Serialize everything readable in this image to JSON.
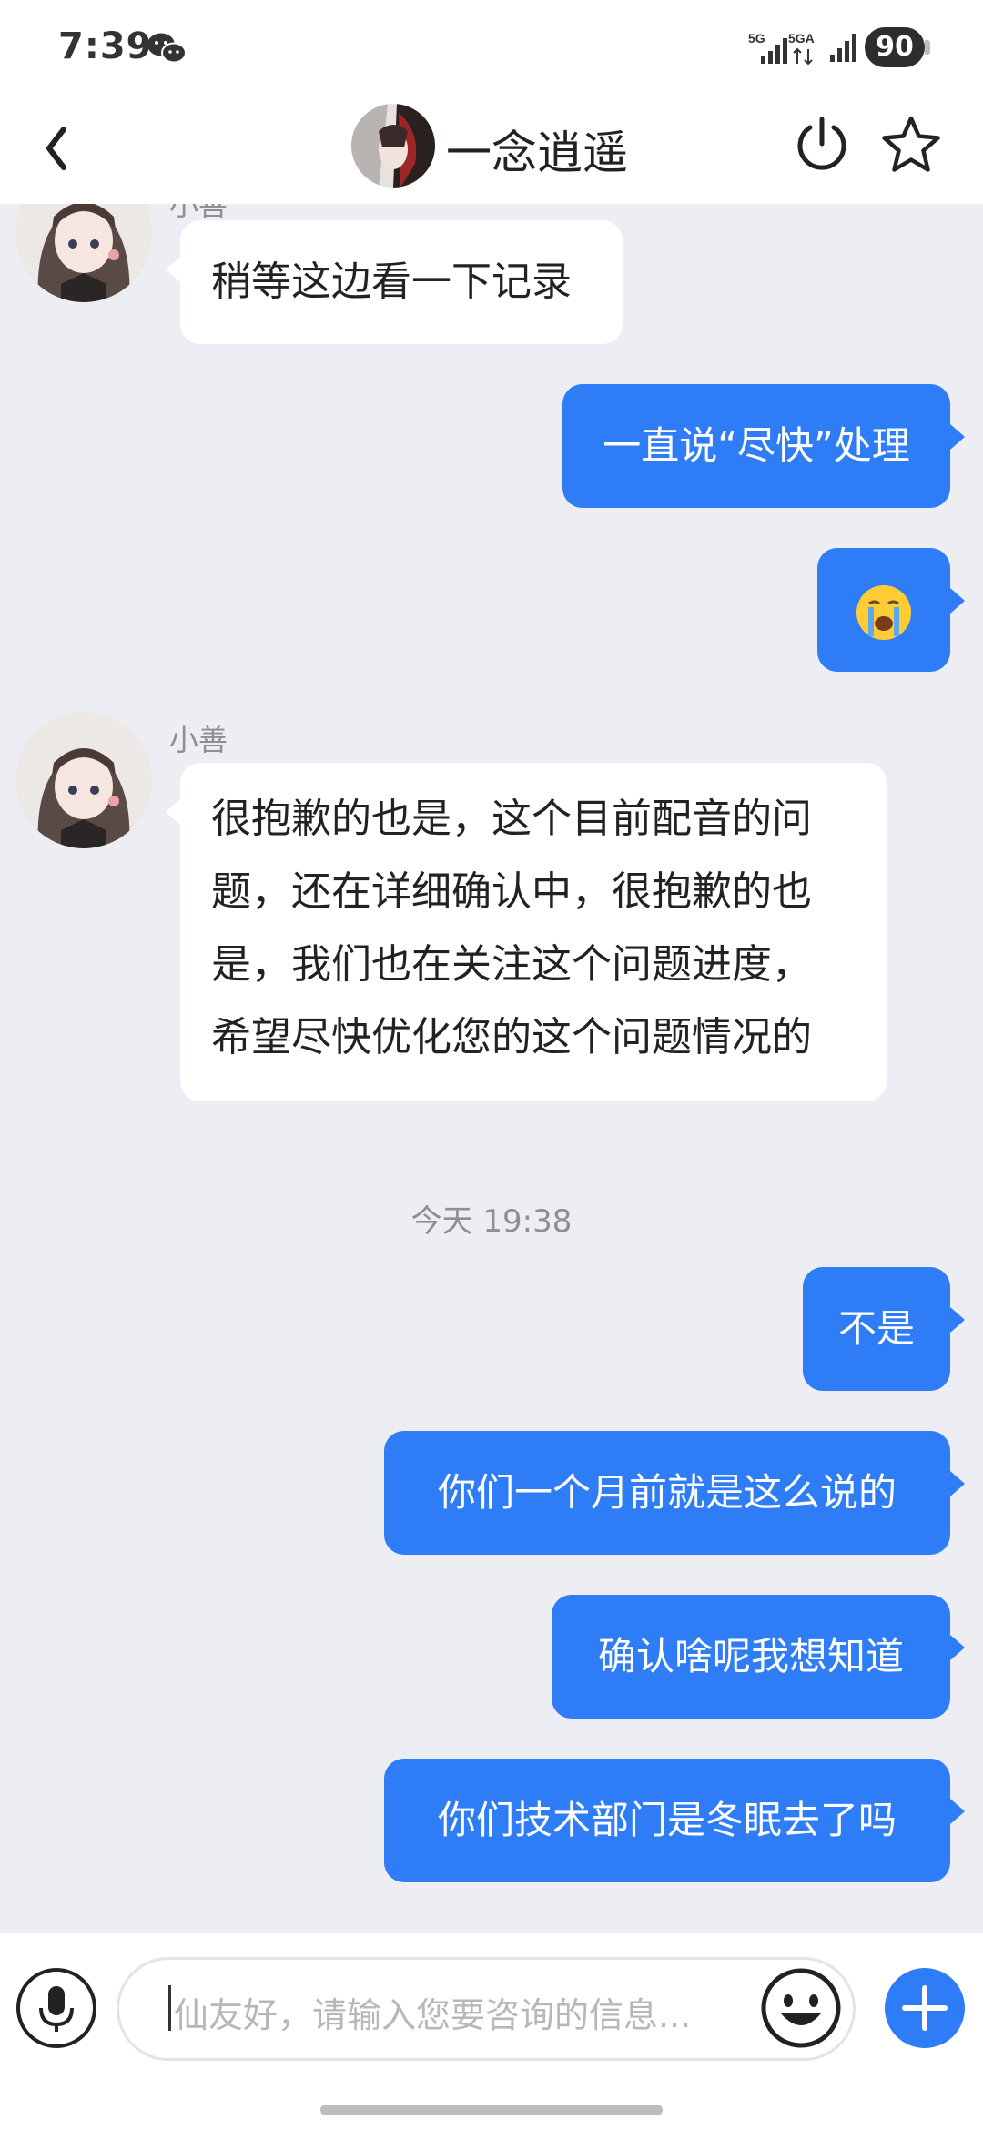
{
  "status_bar": {
    "time": "7:39",
    "signal1_label": "5G",
    "signal2_label": "5GA",
    "battery": "90"
  },
  "header": {
    "title": "一念逍遥"
  },
  "chat": {
    "messages": [
      {
        "side": "in",
        "text": "稍等这边看一下记录"
      },
      {
        "side": "out",
        "text": "一直说“尽快”处理"
      },
      {
        "side": "out",
        "emoji": "😭"
      },
      {
        "side": "in",
        "sender": "小善",
        "lines": [
          "很抱歉的也是，这个目前配音的问",
          "题，还在详细确认中，很抱歉的也",
          "是，我们也在关注这个问题进度，",
          "希望尽快优化您的这个问题情况的"
        ]
      },
      {
        "side": "out",
        "text": "不是"
      },
      {
        "side": "out",
        "text": "你们一个月前就是这么说的"
      },
      {
        "side": "out",
        "text": "确认啥呢我想知道"
      },
      {
        "side": "out",
        "text": "你们技术部门是冬眠去了吗"
      }
    ],
    "timestamp": "今天 19:38"
  },
  "input": {
    "placeholder": "仙友好，请输入您要咨询的信息..."
  },
  "colors": {
    "accent": "#2e7cf6",
    "background": "#eceef3",
    "bubble_in": "#ffffff"
  },
  "icons": [
    "back-icon",
    "power-icon",
    "star-icon",
    "microphone-icon",
    "emoji-icon",
    "plus-icon",
    "wechat-icon"
  ]
}
